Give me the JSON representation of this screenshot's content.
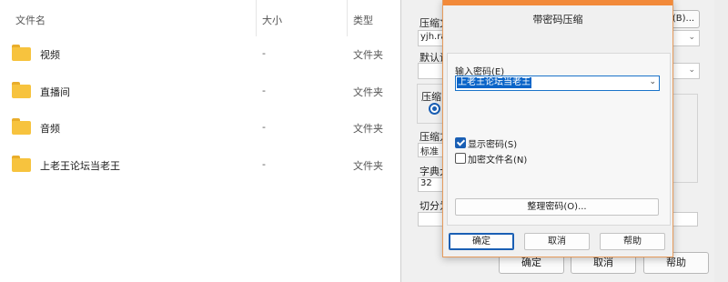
{
  "explorer": {
    "columns": {
      "name": "文件名",
      "size": "大小",
      "type": "类型"
    },
    "rows": [
      {
        "name": "视频",
        "size": "-",
        "type": "文件夹"
      },
      {
        "name": "直播间",
        "size": "-",
        "type": "文件夹"
      },
      {
        "name": "音频",
        "size": "-",
        "type": "文件夹"
      },
      {
        "name": "上老王论坛当老王",
        "size": "-",
        "type": "文件夹"
      }
    ]
  },
  "bg_dialog": {
    "archive_label": "压缩文",
    "archive_value": "yjh.rar",
    "browse_label": "(B)...",
    "default_label": "默认设",
    "compress_group_label": "压缩",
    "method_label": "压缩方",
    "method_value": "标准",
    "dict_label": "字典大",
    "dict_value": "32",
    "split_label": "切分为",
    "ok_label": "确定",
    "cancel_label": "取消",
    "help_label": "帮助"
  },
  "pw_dialog": {
    "title": "带密码压缩",
    "password_label": "输入密码(E)",
    "password_value": "上老王论坛当老王",
    "show_password": {
      "label": "显示密码(S)",
      "checked": true
    },
    "encrypt_names": {
      "label": "加密文件名(N)",
      "checked": false
    },
    "organize_label": "整理密码(O)...",
    "ok_label": "确定",
    "cancel_label": "取消",
    "help_label": "帮助"
  },
  "colors": {
    "accent_orange": "#f28a3a",
    "selection_blue": "#0a64c8",
    "folder_yellow": "#f7c33e"
  }
}
